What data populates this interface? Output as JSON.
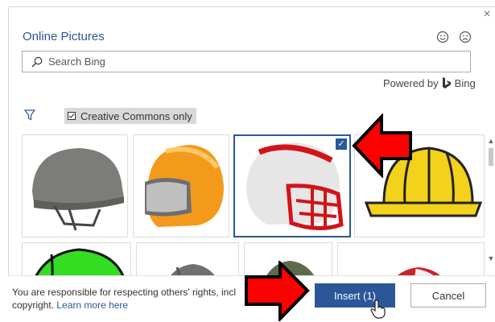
{
  "dialog": {
    "title": "Online Pictures",
    "close_glyph": "×",
    "feedback": {
      "happy_icon": "smiley-icon",
      "sad_icon": "frown-icon"
    }
  },
  "search": {
    "placeholder": "Search Bing",
    "value": ""
  },
  "powered_by": {
    "prefix": "Powered by",
    "brand": "Bing"
  },
  "filter": {
    "icon": "filter-icon",
    "cc_label": "Creative Commons only",
    "cc_checked": true
  },
  "results": {
    "items": [
      {
        "name": "military helmet",
        "selected": false
      },
      {
        "name": "orange motorcycle helmet",
        "selected": false
      },
      {
        "name": "football helmet",
        "selected": true
      },
      {
        "name": "yellow hard hat",
        "selected": false
      },
      {
        "name": "green helmet",
        "selected": false
      },
      {
        "name": "gray helmet",
        "selected": false
      },
      {
        "name": "olive helmet",
        "selected": false
      },
      {
        "name": "red helmet",
        "selected": false
      }
    ],
    "check_glyph": "✓"
  },
  "footer": {
    "notice": "You are responsible for respecting others' rights, incl",
    "notice_line2": "copyright.",
    "learn_more": "Learn more here",
    "insert_label": "Insert (1)",
    "cancel_label": "Cancel"
  },
  "colors": {
    "accent": "#2b579a",
    "annotation_arrow": "#ff0000"
  }
}
